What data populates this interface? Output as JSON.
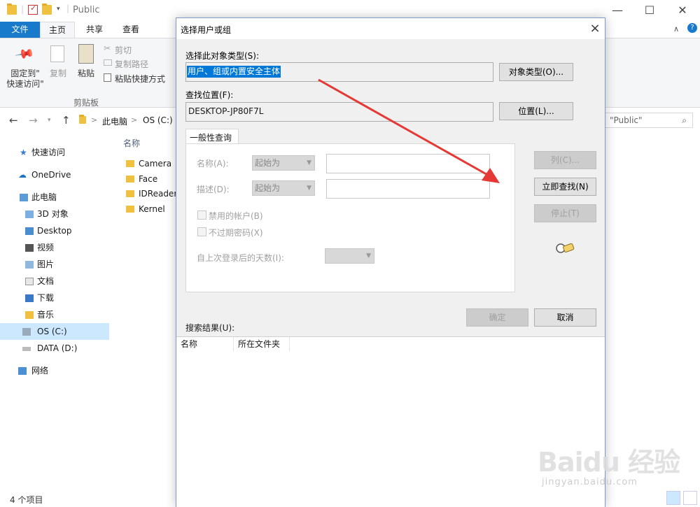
{
  "explorer": {
    "title": "Public",
    "tabs": {
      "file": "文件",
      "home": "主页",
      "share": "共享",
      "view": "查看"
    },
    "ribbon": {
      "pin_label": "固定到\"\n快速访问\"",
      "copy_label": "复制",
      "paste_label": "粘贴",
      "cut_label": "剪切",
      "copy_path_label": "复制路径",
      "paste_shortcut_label": "粘贴快捷方式",
      "group_label": "剪贴板"
    },
    "address": {
      "this_pc": "此电脑",
      "separator": ">",
      "drive": "OS (C:)"
    },
    "search_placeholder": "\"Public\"",
    "nav": [
      {
        "label": "快速访问",
        "icon": "star-icon"
      },
      {
        "label": "OneDrive",
        "icon": "cloud-icon"
      },
      {
        "label": "此电脑",
        "icon": "computer-icon"
      },
      {
        "label": "3D 对象",
        "icon": "cube-icon"
      },
      {
        "label": "Desktop",
        "icon": "desktop-icon"
      },
      {
        "label": "视频",
        "icon": "video-icon"
      },
      {
        "label": "图片",
        "icon": "picture-icon"
      },
      {
        "label": "文档",
        "icon": "document-icon"
      },
      {
        "label": "下载",
        "icon": "download-icon"
      },
      {
        "label": "音乐",
        "icon": "music-icon"
      },
      {
        "label": "OS (C:)",
        "icon": "drive-icon"
      },
      {
        "label": "DATA (D:)",
        "icon": "drive-icon"
      },
      {
        "label": "网络",
        "icon": "network-icon"
      }
    ],
    "files_header": "名称",
    "files": [
      "Camera",
      "Face",
      "IDReader",
      "Kernel"
    ],
    "status": "4 个项目"
  },
  "dialog": {
    "title": "选择用户或组",
    "close": "×",
    "objtype_label": "选择此对象类型(S):",
    "objtype_value": "用户、组或内置安全主体",
    "objtype_button": "对象类型(O)...",
    "location_label": "查找位置(F):",
    "location_value": "DESKTOP-JP80F7L",
    "location_button": "位置(L)...",
    "query_tab": "一般性查询",
    "name_label": "名称(A):",
    "name_combo": "起始为",
    "desc_label": "描述(D):",
    "desc_combo": "起始为",
    "disabled_accounts": "禁用的帐户(B)",
    "no_expire_password": "不过期密码(X)",
    "days_since_login": "自上次登录后的天数(I):",
    "columns_button": "列(C)...",
    "find_now_button": "立即查找(N)",
    "stop_button": "停止(T)",
    "ok_button": "确定",
    "cancel_button": "取消",
    "results_label": "搜索结果(U):",
    "results_columns": [
      "名称",
      "所在文件夹"
    ]
  },
  "watermark": {
    "brand": "Baidu 经验",
    "url": "jingyan.baidu.com"
  },
  "colors": {
    "accent": "#1979ca",
    "selection": "#0078d7",
    "arrow": "#e53935"
  }
}
